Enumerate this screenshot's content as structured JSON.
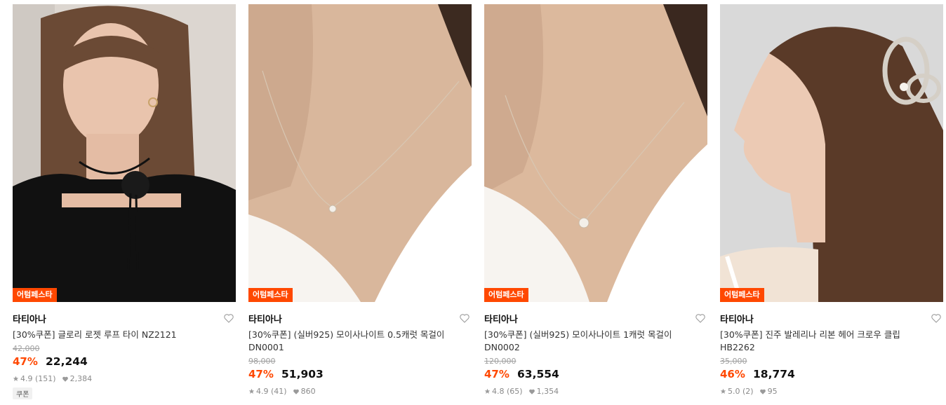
{
  "products": [
    {
      "badge": "어텀페스타",
      "brand": "타티아나",
      "title": "[30%쿠폰] 글로리 로젯 루프 타이 NZ2121",
      "original_price": "42,000",
      "discount": "47%",
      "price": "22,244",
      "rating": "4.9 (151)",
      "likes": "2,384",
      "tag": "쿠폰"
    },
    {
      "badge": "어텀페스타",
      "brand": "타티아나",
      "title": "[30%쿠폰] (실버925) 모이사나이트 0.5캐럿 목걸이 DN0001",
      "original_price": "98,000",
      "discount": "47%",
      "price": "51,903",
      "rating": "4.9 (41)",
      "likes": "860"
    },
    {
      "badge": "어텀페스타",
      "brand": "타티아나",
      "title": "[30%쿠폰] (실버925) 모이사나이트 1캐럿 목걸이 DN0002",
      "original_price": "120,000",
      "discount": "47%",
      "price": "63,554",
      "rating": "4.8 (65)",
      "likes": "1,354"
    },
    {
      "badge": "어텀페스타",
      "brand": "타티아나",
      "title": "[30%쿠폰] 진주 발레리나 리본 헤어 크로우 클립 HB2262",
      "original_price": "35,000",
      "discount": "46%",
      "price": "18,774",
      "rating": "5.0 (2)",
      "likes": "95"
    }
  ],
  "colors": {
    "accent": "#ff4800",
    "muted": "#a0a0a0"
  },
  "icons": [
    "heart-outline-icon",
    "star-icon",
    "heart-filled-icon"
  ]
}
